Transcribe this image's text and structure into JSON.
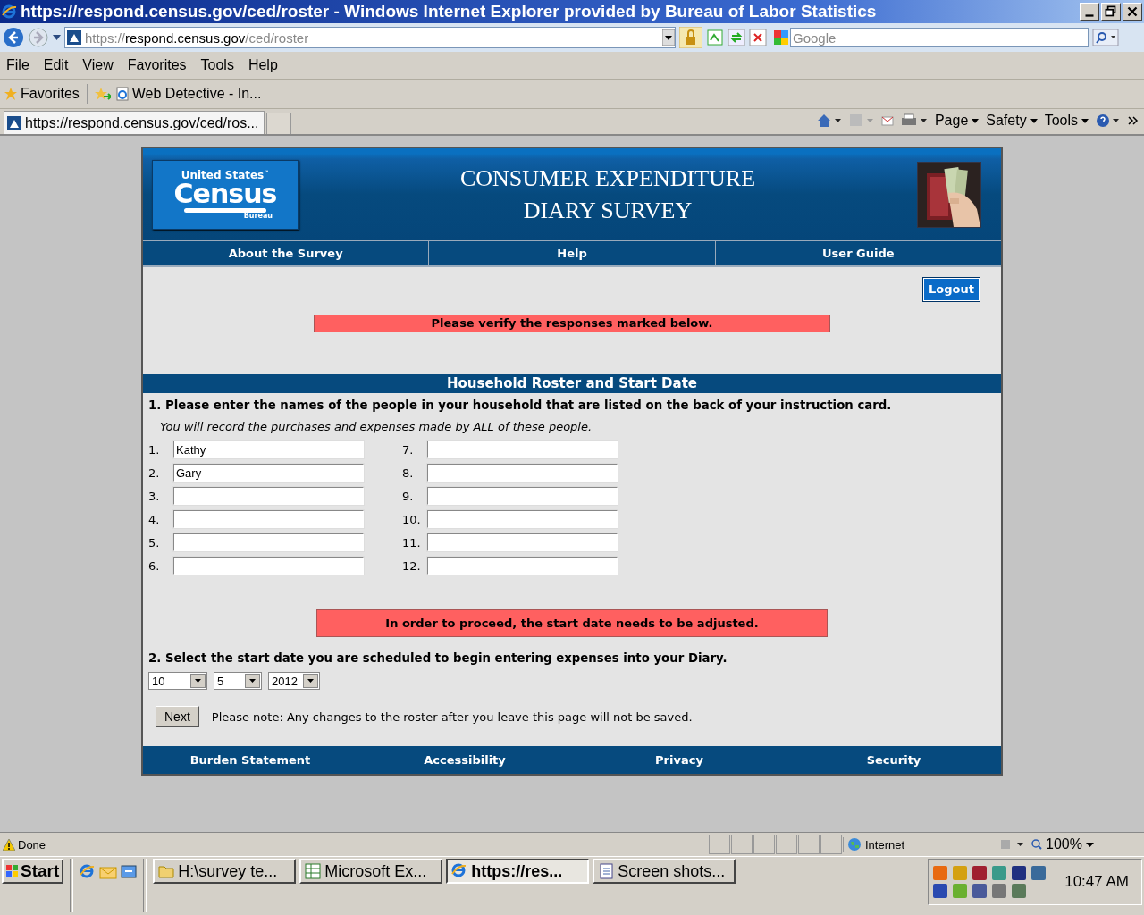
{
  "browser": {
    "title": "https://respond.census.gov/ced/roster - Windows Internet Explorer provided by Bureau of Labor Statistics",
    "address": {
      "scheme": "https://",
      "host": "respond.census.gov",
      "path": "/ced/roster"
    },
    "search": {
      "placeholder": "Google"
    },
    "menu": [
      "File",
      "Edit",
      "View",
      "Favorites",
      "Tools",
      "Help"
    ],
    "favorites_label": "Favorites",
    "favorite_links": [
      "Web Detective - In..."
    ],
    "tab": {
      "label": "https://respond.census.gov/ced/ros...",
      "selected": true
    },
    "commands": [
      "Page",
      "Safety",
      "Tools"
    ]
  },
  "page": {
    "logo": {
      "top": "United States",
      "tm": "™",
      "main": "Census",
      "sub": "Bureau"
    },
    "title_lines": [
      "CONSUMER EXPENDITURE",
      "DIARY SURVEY"
    ],
    "nav": [
      "About the Survey",
      "Help",
      "User Guide"
    ],
    "logout": "Logout",
    "alert_top": "Please verify the responses marked below.",
    "section_title": "Household Roster and Start Date",
    "question_1": "1. Please enter the names of the people in your household that are listed on the back of your instruction card.",
    "note_1": "You will record the purchases and expenses made by ALL of these people.",
    "names": [
      {
        "number": "1.",
        "value": "Kathy"
      },
      {
        "number": "2.",
        "value": "Gary"
      },
      {
        "number": "3."
      },
      {
        "number": "4."
      },
      {
        "number": "5."
      },
      {
        "number": "6."
      },
      {
        "number": "7."
      },
      {
        "number": "8."
      },
      {
        "number": "9."
      },
      {
        "number": "10."
      },
      {
        "number": "11."
      },
      {
        "number": "12."
      }
    ],
    "alert_date": "In order to proceed, the start date needs to be adjusted.",
    "question_2": "2. Select the start date you are scheduled to begin entering expenses into your Diary.",
    "date_selects": [
      {
        "value": "10"
      },
      {
        "value": "5"
      },
      {
        "value": "2012"
      }
    ],
    "next": "Next",
    "note_2": "Please note: Any changes to the roster after you leave this page will not be saved.",
    "footer": [
      "Burden Statement",
      "Accessibility",
      "Privacy",
      "Security"
    ]
  },
  "status_bar": {
    "text": "Done",
    "zone": "Internet",
    "zoom": "100%"
  },
  "taskbar": {
    "start": "Start",
    "tasks": [
      {
        "label": "H:\\survey te...",
        "kind": "folder",
        "selected": false
      },
      {
        "label": "Microsoft Ex...",
        "kind": "spreadsheet",
        "selected": false
      },
      {
        "label": "https://res...",
        "kind": "browser",
        "selected": true
      },
      {
        "label": "Screen shots...",
        "kind": "document",
        "selected": false
      }
    ],
    "clock": "10:47 AM"
  }
}
